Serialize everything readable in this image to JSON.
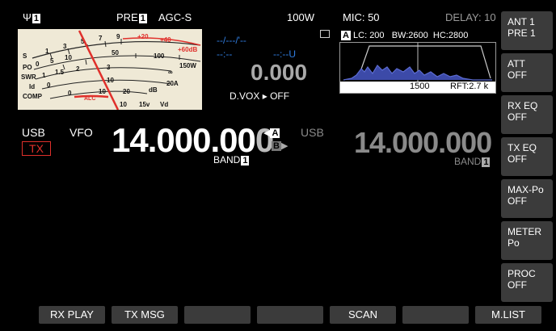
{
  "status": {
    "antenna_num": "1",
    "pre_label": "PRE",
    "pre_num": "1",
    "agc": "AGC-S",
    "power": "100W",
    "mic_label": "MIC:",
    "mic_value": "50",
    "delay": "DELAY: 10"
  },
  "meter": {
    "scale_s": "S",
    "scale_po": "PO",
    "scale_swr": "SWR",
    "scale_id": "Id",
    "scale_comp": "COMP",
    "alc": "ALC",
    "s_ticks": [
      "1",
      "3",
      "5",
      "7",
      "9",
      "+20",
      "+40",
      "+60dB"
    ],
    "po_ticks": [
      "0",
      "5",
      "10",
      "50",
      "100",
      "150W"
    ],
    "swr_ticks": [
      "1",
      "1.5",
      "2",
      "3",
      "∞"
    ],
    "id_ticks": [
      "0",
      "10",
      "20A"
    ],
    "comp_ticks": [
      "0",
      "10",
      "20",
      "dB"
    ],
    "vd_ticks": [
      "10",
      "15v",
      "Vd"
    ]
  },
  "middle": {
    "time1": "--/---/'--",
    "time2": "--:--",
    "time3": "--:--U",
    "rit_value": "0.000",
    "dvox_label": "D.VOX",
    "dvox_state": "OFF"
  },
  "scope": {
    "badge": "A",
    "lc": "LC: 200",
    "bw": "BW:2600",
    "hc": "HC:2800",
    "center": "1500",
    "rft": "RFT:2.7 k"
  },
  "vfo_a": {
    "mode": "USB",
    "source": "VFO",
    "tx": "TX",
    "freq_main": "14.000.00",
    "freq_last": "0",
    "band_label": "BAND",
    "band_num": "1",
    "a_marker": "A",
    "b_marker": "B"
  },
  "vfo_b": {
    "mode": "USB",
    "freq": "14.000.000",
    "band_label": "BAND",
    "band_num": "1"
  },
  "right_buttons": [
    {
      "l1": "ANT 1",
      "l2": "PRE 1"
    },
    {
      "l1": "ATT",
      "l2": "OFF"
    },
    {
      "l1": "RX EQ",
      "l2": "OFF"
    },
    {
      "l1": "TX EQ",
      "l2": "OFF"
    },
    {
      "l1": "MAX-Po",
      "l2": "OFF"
    },
    {
      "l1": "METER",
      "l2": "Po"
    },
    {
      "l1": "PROC",
      "l2": "OFF"
    }
  ],
  "bottom_buttons": [
    "RX PLAY",
    "TX MSG",
    "",
    "",
    "SCAN",
    "",
    "M.LIST"
  ]
}
